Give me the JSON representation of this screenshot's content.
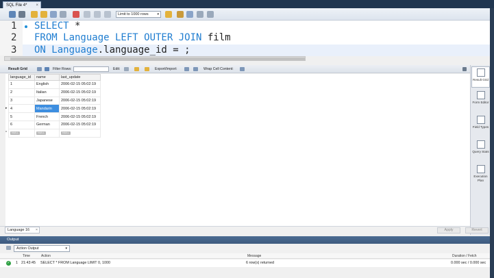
{
  "editor_tab": {
    "title": "SQL File 4*",
    "close": "×"
  },
  "toolbar": {
    "limit_value": "Limit to 1000 rows",
    "limit_arrow": "▾"
  },
  "editor": {
    "line_numbers": [
      "1",
      "2",
      "3"
    ],
    "line1": {
      "kw": "SELECT",
      "rest": " *"
    },
    "line2": {
      "kw": "FROM Language LEFT OUTER JOIN",
      "rest": " film"
    },
    "line3": {
      "kw": "ON Language",
      "rest": ".language_id = ;"
    }
  },
  "result_toolbar": {
    "result_grid": "Result Grid",
    "filter_rows": "Filter Rows:",
    "edit": "Edit:",
    "export_import": "Export/Import:",
    "wrap_cell": "Wrap Cell Content:"
  },
  "grid": {
    "columns": [
      "language_id",
      "name",
      "last_update"
    ],
    "rows": [
      [
        "1",
        "English",
        "2006-02-15 05:02:19"
      ],
      [
        "2",
        "Italian",
        "2006-02-15 05:02:19"
      ],
      [
        "3",
        "Japanese",
        "2006-02-15 05:02:19"
      ],
      [
        "4",
        "Mandarin",
        "2006-02-15 05:02:19"
      ],
      [
        "5",
        "French",
        "2006-02-15 05:02:19"
      ],
      [
        "6",
        "German",
        "2006-02-15 05:02:19"
      ]
    ],
    "null_label": "NULL"
  },
  "right_panel": {
    "result_grid": "Result Grid",
    "form_editor": "Form Editor",
    "field_types": "Field Types",
    "query_stats": "Query Stats",
    "execution_plan": "Execution Plan"
  },
  "status": {
    "result_tab": "Language 16",
    "close": "×",
    "apply": "Apply",
    "revert": "Revert"
  },
  "output": {
    "header": "Output",
    "selector": "Action Output",
    "columns": {
      "time": "Time",
      "action": "Action",
      "message": "Message",
      "duration": "Duration / Fetch"
    },
    "row": {
      "num": "1",
      "time": "21:43:45",
      "action": "SELECT * FROM Language LIMIT 0, 1000",
      "message": "6 row(s) returned",
      "duration": "0.000 sec / 0.000 sec"
    }
  },
  "colors": {
    "keyword": "#1f7dd0",
    "selection": "#3d8ee0",
    "output_header": "#4b6b91",
    "success": "#2ea043"
  }
}
